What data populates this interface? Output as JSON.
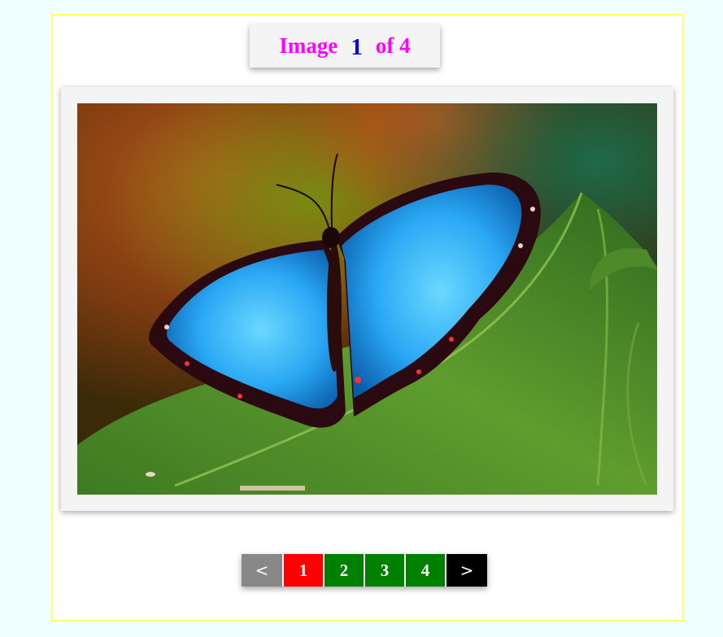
{
  "counter": {
    "prefix": "Image",
    "current": "1",
    "suffix": "of 4"
  },
  "slideshow": {
    "image_subject": "blue morpho butterfly on green leaf",
    "total": 4,
    "current_index": 1
  },
  "pager": {
    "prev_label": "<",
    "next_label": ">",
    "pages": [
      "1",
      "2",
      "3",
      "4"
    ],
    "colors": {
      "prev": "#888888",
      "active": "#ff0000",
      "inactive": "#008000",
      "next": "#000000"
    }
  },
  "colors": {
    "background": "#f0ffff",
    "frame_border": "#ffff66",
    "counter_text": "#ff00ff",
    "counter_current": "#0000ee"
  }
}
